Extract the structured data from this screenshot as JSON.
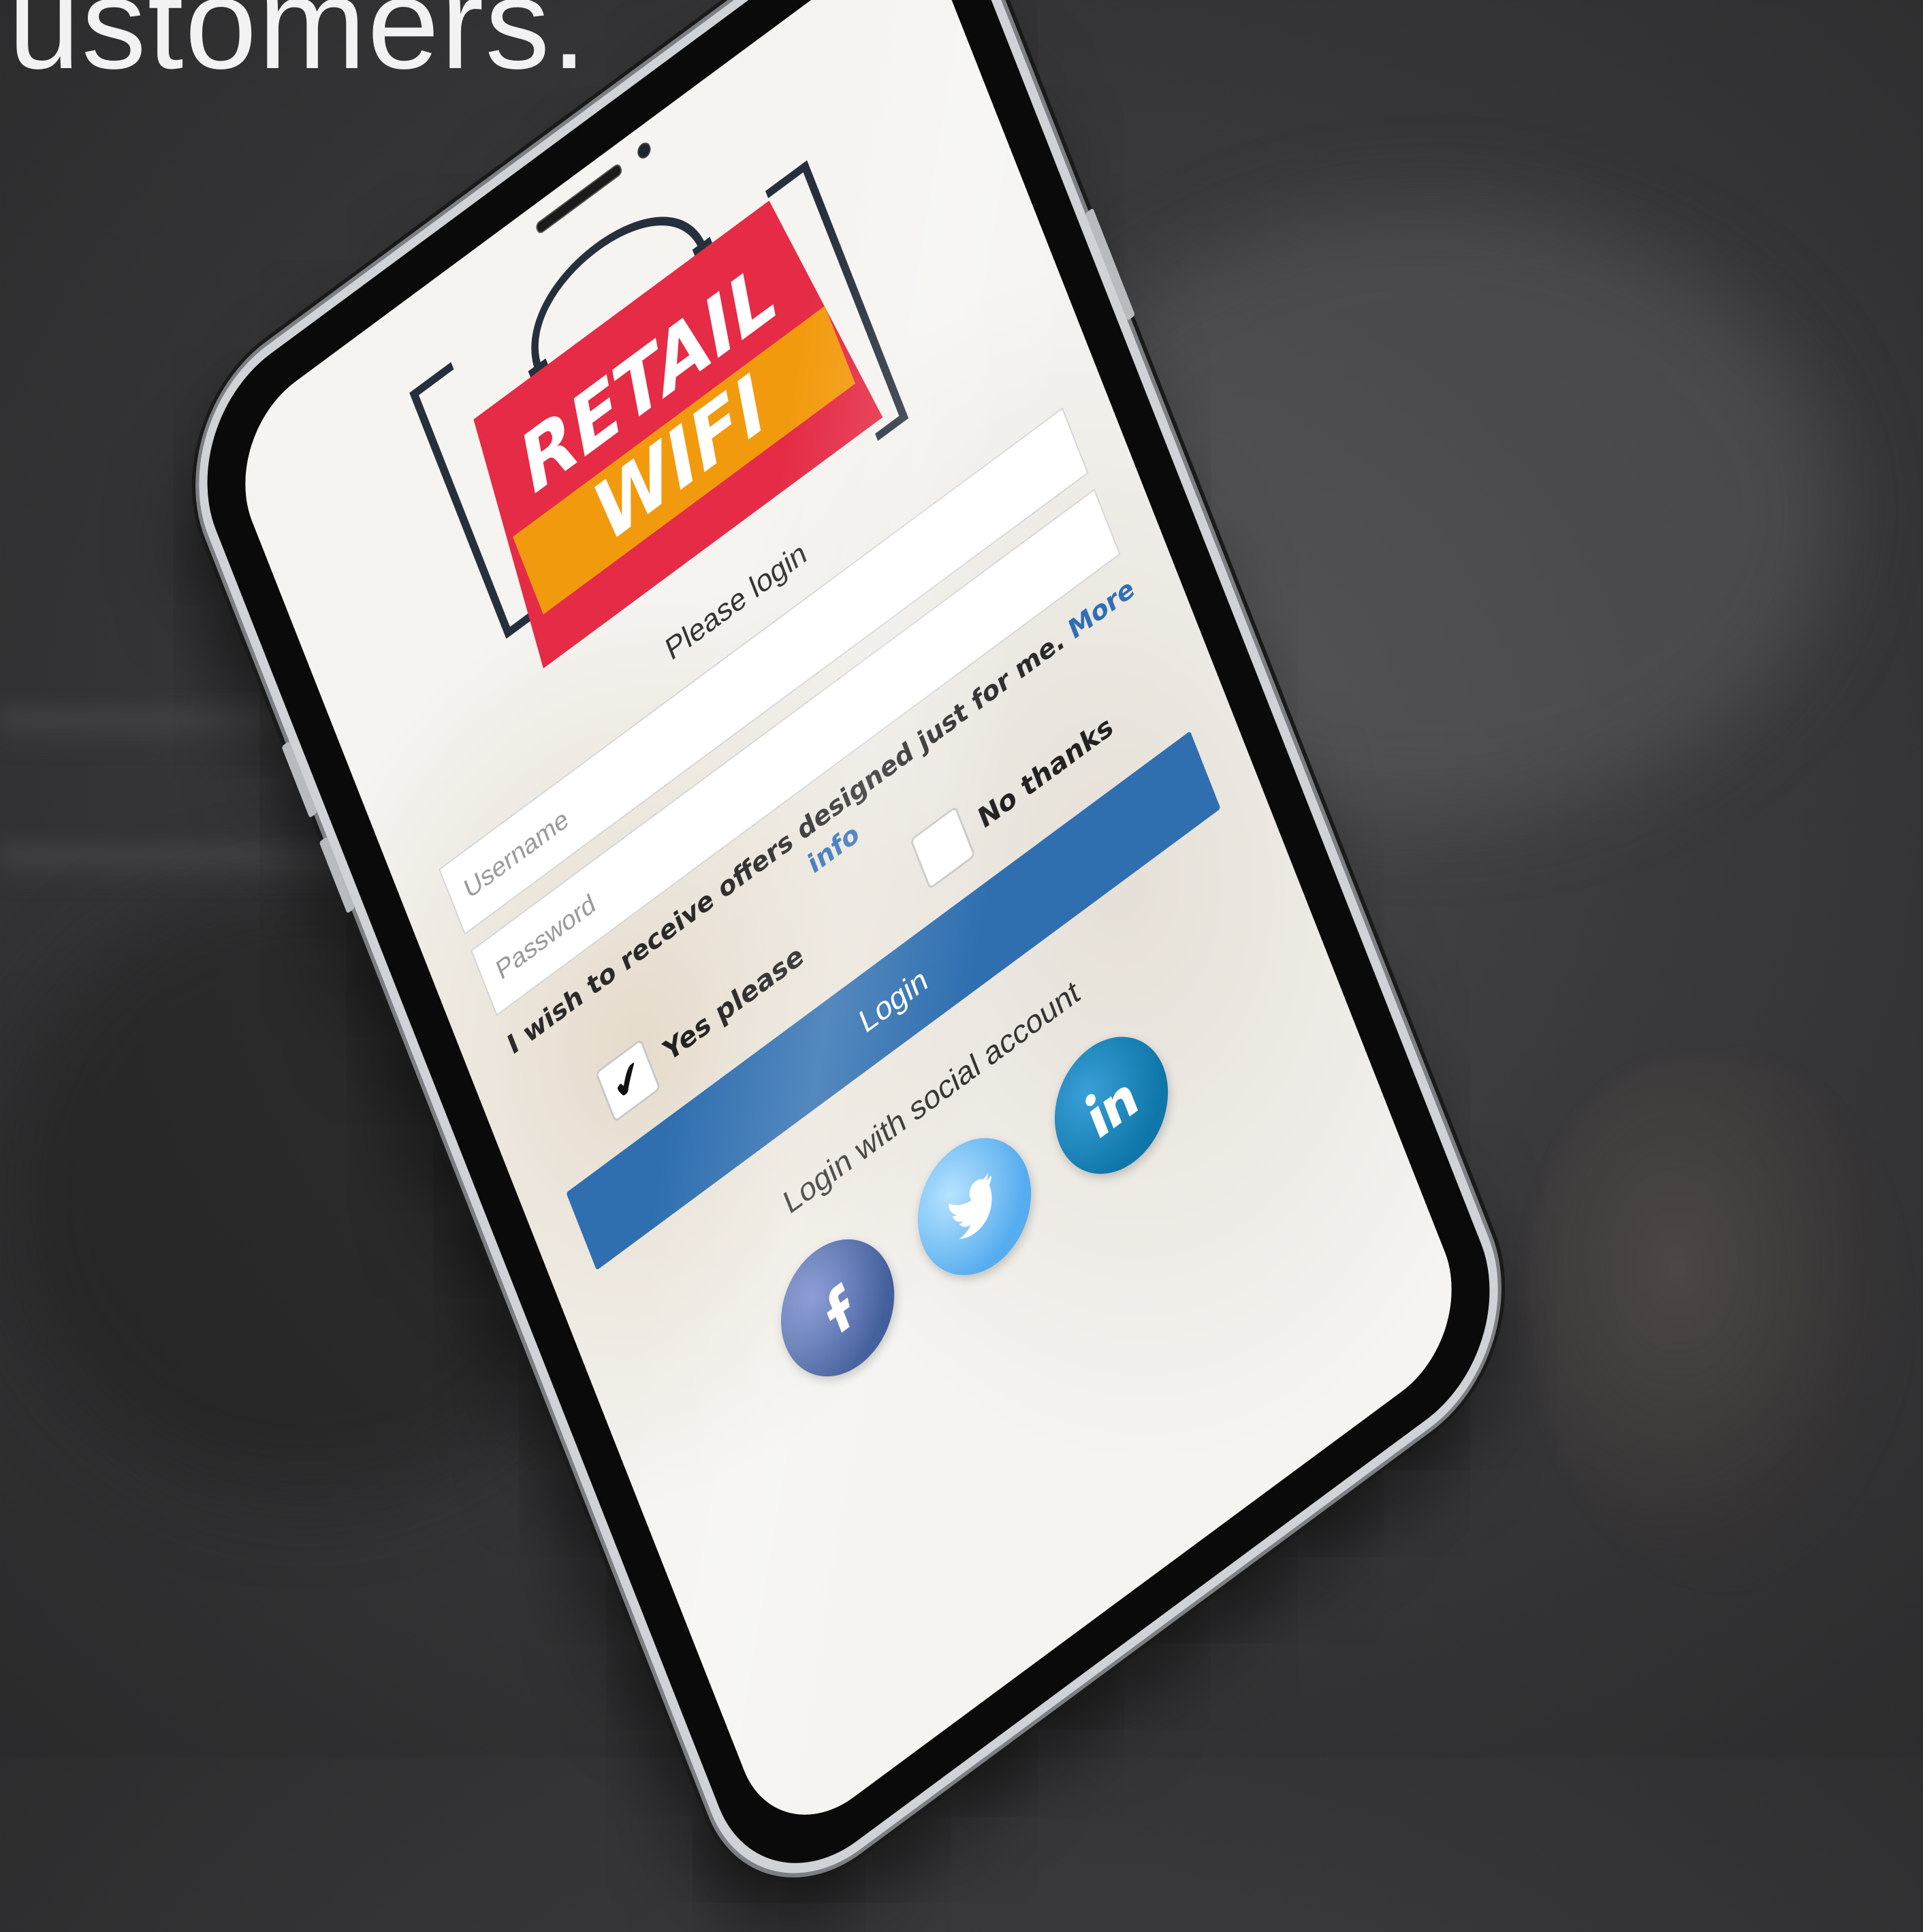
{
  "headline": "ustomers.",
  "logo": {
    "line1": "RETAIL",
    "line2": "WIFI"
  },
  "login": {
    "title": "Please login",
    "username_placeholder": "Username",
    "password_placeholder": "Password",
    "offer_text": "I wish to receive offers designed just for me.",
    "more_info": "More info",
    "yes_label": "Yes please",
    "yes_checked": true,
    "no_label": "No thanks",
    "no_checked": false,
    "button": "Login"
  },
  "social": {
    "title": "Login with social account",
    "items": [
      {
        "network": "Facebook",
        "icon": "facebook-icon",
        "color": "#3b5998"
      },
      {
        "network": "Twitter",
        "icon": "twitter-icon",
        "color": "#55acee"
      },
      {
        "network": "LinkedIn",
        "icon": "linkedin-icon",
        "color": "#0e76a8"
      }
    ]
  },
  "colors": {
    "brand_red": "#e52b45",
    "brand_orange": "#f29a0e",
    "button_blue": "#2f6fb0",
    "link_blue": "#2f6fb5"
  }
}
